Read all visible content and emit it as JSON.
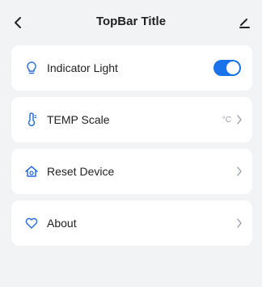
{
  "topbar": {
    "title": "TopBar Title",
    "back_icon": "chevron-left-icon",
    "edit_icon": "edit-pencil-icon"
  },
  "settings": {
    "indicator_light": {
      "label": "Indicator Light",
      "icon": "lightbulb-icon",
      "toggle_on": true
    },
    "temp_scale": {
      "label": "TEMP Scale",
      "icon": "thermometer-icon",
      "value": "°C"
    },
    "reset_device": {
      "label": "Reset Device",
      "icon": "home-reset-icon"
    },
    "about": {
      "label": "About",
      "icon": "heart-icon"
    }
  },
  "colors": {
    "accent": "#1a73e8",
    "icon": "#2a6fdb",
    "background": "#f2f3f5",
    "card": "#ffffff"
  }
}
